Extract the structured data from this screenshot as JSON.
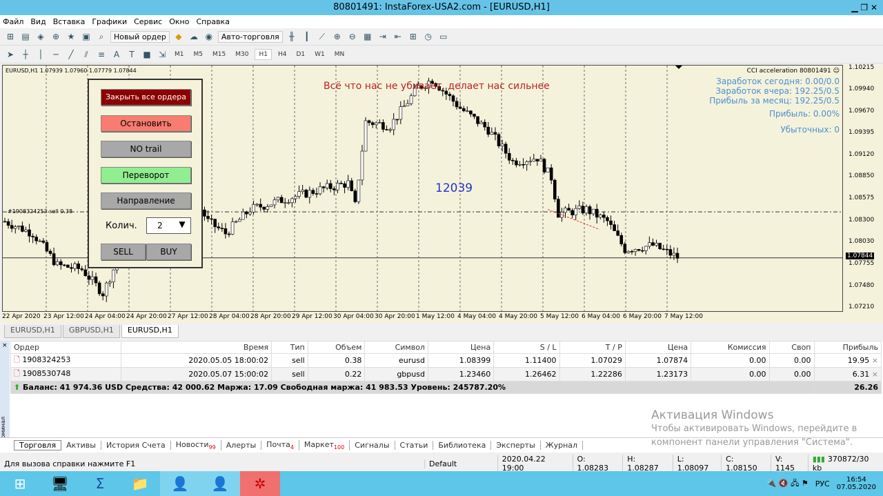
{
  "window": {
    "title": "80801491: InstaForex-USA2.com - [EURUSD,H1]"
  },
  "menu": [
    "Файл",
    "Вид",
    "Вставка",
    "Графики",
    "Сервис",
    "Окно",
    "Справка"
  ],
  "toolbar": {
    "new_order": "Новый ордер",
    "autotrade": "Авто-торговля"
  },
  "timeframes": [
    "M1",
    "M5",
    "M15",
    "M30",
    "H1",
    "H4",
    "D1",
    "W1",
    "MN"
  ],
  "active_timeframe": "H1",
  "chart": {
    "header": "EURUSD,H1  1.07939 1.07960 1.07779 1.07844",
    "motto": "Всё что нас не убивает, делает нас сильнее",
    "counter": "12039",
    "order_line_label": "#1908324253 sell 0.38",
    "indicator": "CCI acceleration  80801491 ☺",
    "info": [
      "Заработок сегодня: 0.00/0.0",
      "Заработок вчера: 192.25/0.5",
      "Прибыль за месяц: 192.25/0.5",
      "Прибыль: 0.00%",
      "Убыточных: 0"
    ],
    "current_price": "1.07844",
    "price_ticks": [
      "1.10215",
      "1.09940",
      "1.09670",
      "1.09395",
      "1.09120",
      "1.08850",
      "1.08575",
      "1.08300",
      "1.08030",
      "1.07755",
      "1.07480",
      "1.07210"
    ],
    "time_ticks": [
      "22 Apr 2020",
      "23 Apr 12:00",
      "24 Apr 04:00",
      "24 Apr 20:00",
      "27 Apr 12:00",
      "28 Apr 04:00",
      "28 Apr 20:00",
      "29 Apr 12:00",
      "30 Apr 04:00",
      "30 Apr 20:00",
      "1 May 12:00",
      "4 May 04:00",
      "4 May 20:00",
      "5 May 12:00",
      "6 May 04:00",
      "6 May 20:00",
      "7 May 12:00"
    ]
  },
  "chart_data": {
    "type": "candlestick",
    "symbol": "EURUSD",
    "timeframe": "H1",
    "ylim": [
      1.0721,
      1.1022
    ],
    "approx_close_path": [
      [
        0,
        1.083
      ],
      [
        8,
        1.0815
      ],
      [
        15,
        1.0775
      ],
      [
        22,
        1.077
      ],
      [
        28,
        1.074
      ],
      [
        33,
        1.079
      ],
      [
        40,
        1.08
      ],
      [
        45,
        1.084
      ],
      [
        52,
        1.0875
      ],
      [
        58,
        1.083
      ],
      [
        63,
        1.0815
      ],
      [
        70,
        1.0845
      ],
      [
        80,
        1.0858
      ],
      [
        90,
        1.087
      ],
      [
        98,
        1.0878
      ],
      [
        100,
        1.085
      ],
      [
        103,
        1.0955
      ],
      [
        110,
        1.095
      ],
      [
        118,
        1.0998
      ],
      [
        122,
        1.1008
      ],
      [
        130,
        1.0972
      ],
      [
        138,
        1.0945
      ],
      [
        145,
        1.0905
      ],
      [
        152,
        1.091
      ],
      [
        156,
        1.0885
      ],
      [
        158,
        1.084
      ],
      [
        166,
        1.0845
      ],
      [
        172,
        1.083
      ],
      [
        177,
        1.0795
      ],
      [
        185,
        1.08
      ],
      [
        192,
        1.0785
      ]
    ]
  },
  "panel": {
    "close_all": "Закрыть все ордера",
    "stop": "Остановить",
    "trail": "NO trail",
    "reverse": "Переворот",
    "direction": "Направление",
    "qty_label": "Колич.",
    "qty": "2",
    "sell": "SELL",
    "buy": "BUY"
  },
  "chart_tabs": [
    "EURUSD,H1",
    "GBPUSD,H1",
    "EURUSD,H1"
  ],
  "terminal": {
    "columns": [
      "Ордер",
      "Время",
      "Тип",
      "Объем",
      "Символ",
      "Цена",
      "S / L",
      "T / P",
      "Цена",
      "Комиссия",
      "Своп",
      "Прибыль"
    ],
    "rows": [
      [
        "1908324253",
        "2020.05.05 18:00:02",
        "sell",
        "0.38",
        "eurusd",
        "1.08399",
        "1.11400",
        "1.07029",
        "1.07874",
        "0.00",
        "0.00",
        "19.95"
      ],
      [
        "1908530748",
        "2020.05.07 15:00:02",
        "sell",
        "0.22",
        "gbpusd",
        "1.23460",
        "1.26462",
        "1.22286",
        "1.23173",
        "0.00",
        "0.00",
        "6.31"
      ]
    ],
    "summary": "Баланс: 41 974.36 USD  Средства: 42 000.62  Маржа: 17.09  Свободная маржа: 41 983.53  Уровень: 245787.20%",
    "total": "26.26",
    "side_label": "Терминал"
  },
  "bottom_tabs": [
    {
      "label": "Торговля"
    },
    {
      "label": "Активы"
    },
    {
      "label": "История Счета"
    },
    {
      "label": "Новости",
      "badge": "99"
    },
    {
      "label": "Алерты"
    },
    {
      "label": "Почта",
      "badge": "4"
    },
    {
      "label": "Маркет",
      "badge": "100"
    },
    {
      "label": "Сигналы"
    },
    {
      "label": "Статьи"
    },
    {
      "label": "Библиотека"
    },
    {
      "label": "Эксперты"
    },
    {
      "label": "Журнал"
    }
  ],
  "status": {
    "help": "Для вызова справки нажмите F1",
    "profile": "Default",
    "time": "2020.04.22 19:00",
    "o": "O: 1.08283",
    "h": "H: 1.08287",
    "l": "L: 1.08097",
    "c": "C: 1.08150",
    "v": "V: 1145",
    "traffic": "370872/30 kb"
  },
  "watermark": {
    "title": "Активация Windows",
    "line1": "Чтобы активировать Windows, перейдите в",
    "line2": "компонент панели управления \"Система\"."
  },
  "taskbar": {
    "lang": "РУС",
    "time": "16:54",
    "date": "07.05.2020"
  }
}
